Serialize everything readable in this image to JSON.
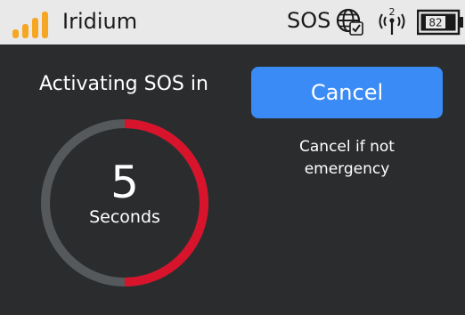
{
  "status_bar": {
    "signal_icon": "signal-bars-icon",
    "carrier": "Iridium",
    "sos_label": "SOS",
    "globe_icon": "globe-icon",
    "antenna_icon": "satellite-antenna-icon",
    "antenna_number": "2",
    "battery_icon": "battery-icon",
    "battery_level": "82",
    "background_color": "#e9e9e9",
    "signal_color": "#f5a623"
  },
  "countdown": {
    "title": "Activating SOS in",
    "value": "5",
    "unit": "Seconds",
    "progress_fraction": 0.5,
    "track_color": "#56595c",
    "progress_color": "#d7142b"
  },
  "actions": {
    "cancel_label": "Cancel",
    "cancel_color": "#3a8bf5",
    "hint_line1": "Cancel if not",
    "hint_line2": "emergency"
  }
}
